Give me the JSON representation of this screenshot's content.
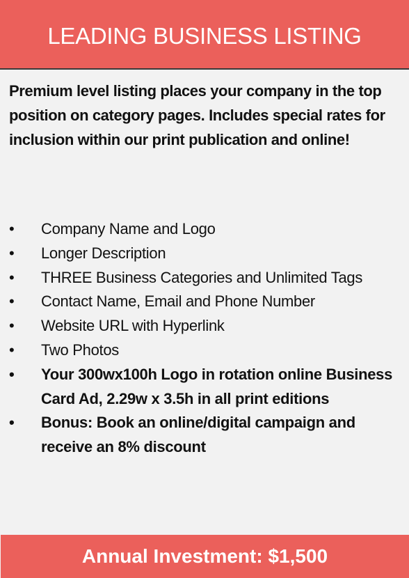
{
  "header": {
    "title": "LEADING BUSINESS LISTING"
  },
  "intro": "Premium level listing places your company in the top position on category pages.  Includes special rates for inclusion within our print publication and online!",
  "bullets": [
    {
      "text": "Company Name and Logo",
      "bold": false
    },
    {
      "text": "Longer Description",
      "bold": false
    },
    {
      "text": "THREE Business Categories and Unlimited Tags",
      "bold": false
    },
    {
      "text": "Contact Name, Email and Phone Number",
      "bold": false
    },
    {
      "text": "Website URL with Hyperlink",
      "bold": false
    },
    {
      "text": "Two Photos",
      "bold": false
    },
    {
      "text": "Your 300wx100h Logo in rotation online Business Card Ad, 2.29w x 3.5h in all print editions",
      "bold": true
    },
    {
      "text": "Bonus: Book an online/digital campaign and receive an 8% discount",
      "bold": true
    }
  ],
  "bullet_glyph": "•",
  "footer": {
    "text": "Annual Investment: $1,500"
  },
  "colors": {
    "accent": "#eb605b",
    "background": "#f2f2f2"
  }
}
